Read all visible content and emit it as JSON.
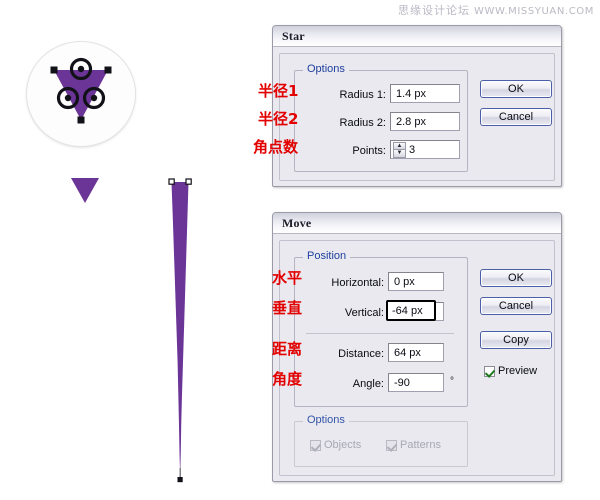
{
  "watermark": {
    "cn": "思缘设计论坛",
    "url": "WWW.MISSYUAN.COM"
  },
  "artwork": {
    "badge_name": "triangle-with-anchor-points-preview",
    "small_triangle_name": "small-purple-triangle",
    "spire_name": "tapered-purple-spire",
    "purple": "#6B3497",
    "purple_dark": "#5B2B82",
    "purple_light": "#7B4AA8"
  },
  "star_dialog": {
    "title": "Star",
    "group_label": "Options",
    "fields": [
      {
        "label": "Radius 1:",
        "value": "1.4 px",
        "annotation": "半径1"
      },
      {
        "label": "Radius 2:",
        "value": "2.8 px",
        "annotation": "半径2"
      },
      {
        "label": "Points:",
        "value": "3",
        "annotation": "角点数"
      }
    ],
    "buttons": [
      {
        "label": "OK"
      },
      {
        "label": "Cancel"
      }
    ]
  },
  "move_dialog": {
    "title": "Move",
    "position_group_label": "Position",
    "options_group_label": "Options",
    "fields": [
      {
        "label": "Horizontal:",
        "value": "0 px",
        "annotation": "水平",
        "unit": ""
      },
      {
        "label": "Vertical:",
        "value": "-64 px",
        "annotation": "垂直",
        "unit": ""
      },
      {
        "label": "Distance:",
        "value": "64 px",
        "annotation": "距离",
        "unit": ""
      },
      {
        "label": "Angle:",
        "value": "-90",
        "annotation": "角度",
        "unit": "°"
      }
    ],
    "buttons": [
      {
        "label": "OK"
      },
      {
        "label": "Cancel"
      },
      {
        "label": "Copy"
      }
    ],
    "preview_checkbox": {
      "label": "Preview",
      "checked": true
    },
    "option_checkboxes": [
      {
        "label": "Objects",
        "checked": true,
        "enabled": false
      },
      {
        "label": "Patterns",
        "checked": true,
        "enabled": false
      }
    ]
  }
}
